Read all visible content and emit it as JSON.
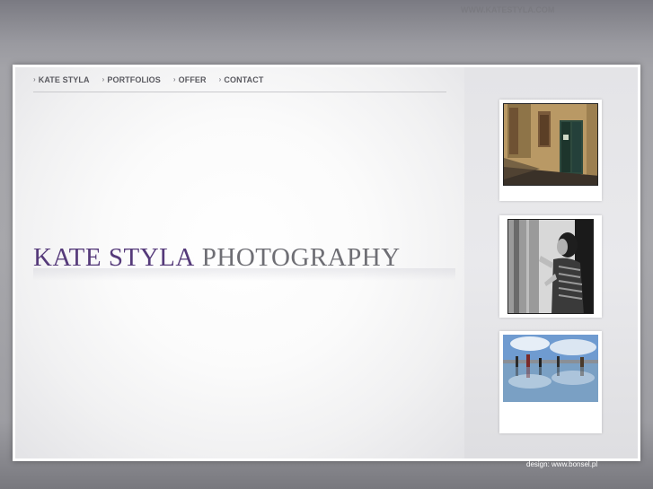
{
  "nav": {
    "items": [
      {
        "label": "KATE STYLA"
      },
      {
        "label": "PORTFOLIOS"
      },
      {
        "label": "OFFER"
      },
      {
        "label": "CONTACT"
      }
    ],
    "arrow": "›"
  },
  "site_url": "WWW.KATESTYLA.COM",
  "logo": {
    "name": "KATE STYLA",
    "word": "PHOTOGRAPHY"
  },
  "thumbnails": [
    {
      "subject": "old-doorway-street"
    },
    {
      "subject": "woman-leaning-on-wall"
    },
    {
      "subject": "people-reflecting-water-square"
    }
  ],
  "credit": "design: www.bonsel.pl",
  "colors": {
    "logo_name": "#553a7a",
    "logo_word": "#6e6e74",
    "nav_text": "#5a5a60"
  }
}
